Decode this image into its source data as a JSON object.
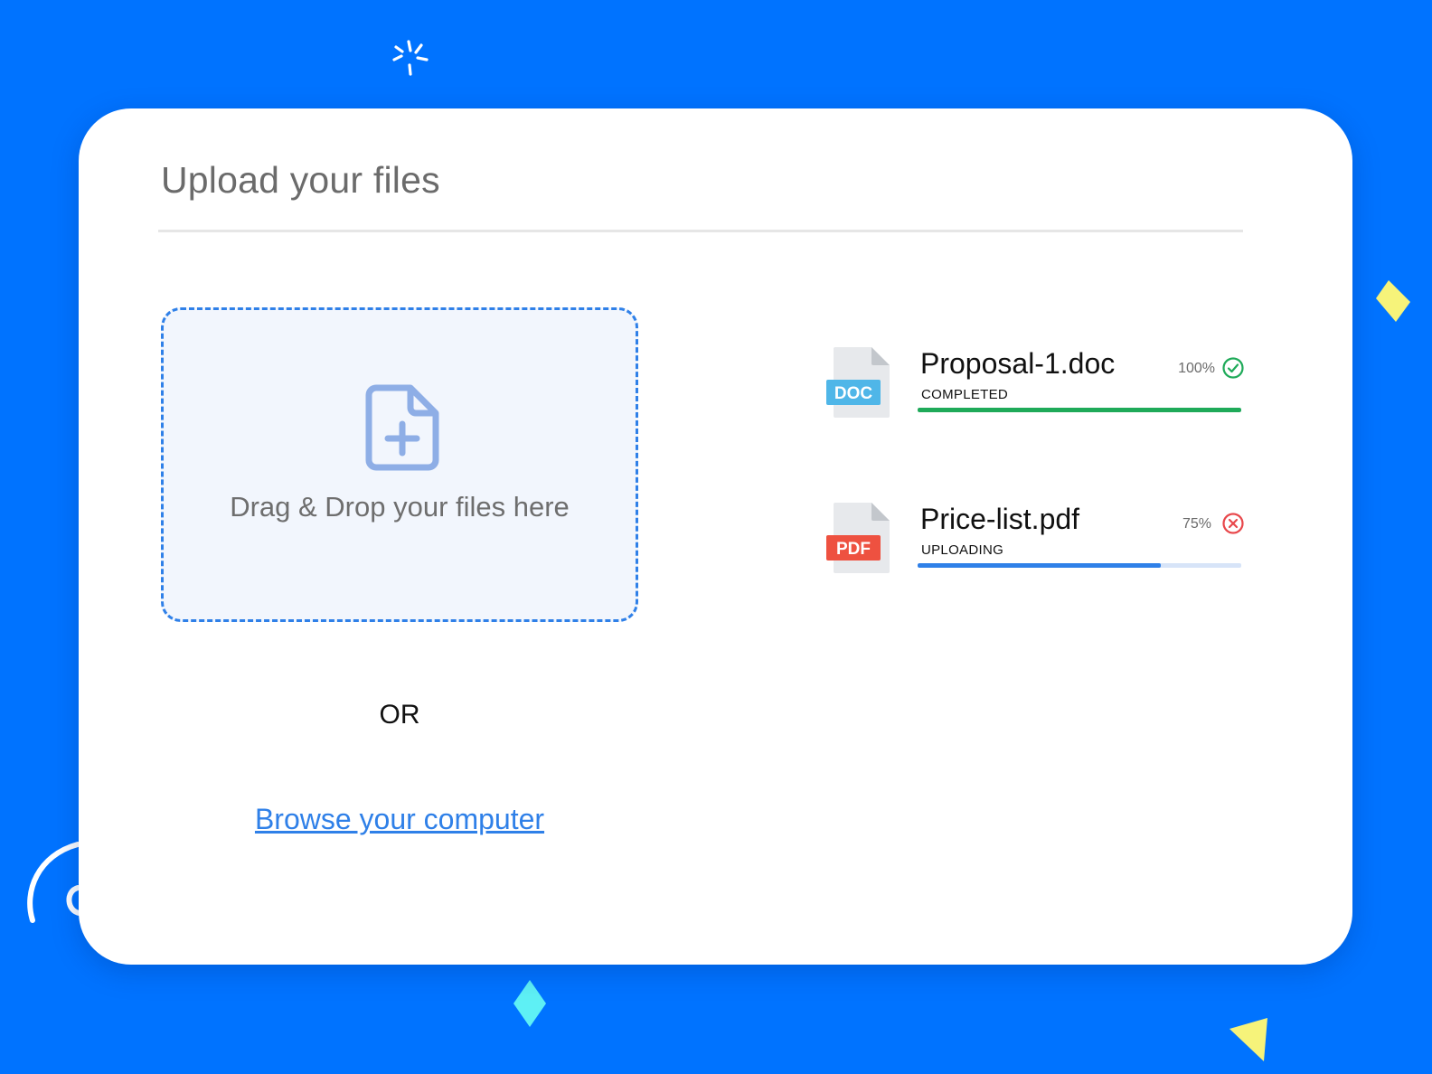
{
  "colors": {
    "background": "#0073ff",
    "card": "#ffffff",
    "accent_blue": "#2f80e8",
    "success_green": "#1faa59",
    "error_red": "#e8474b",
    "doc_badge": "#4fb6e8",
    "pdf_badge": "#ee5140"
  },
  "header": {
    "title": "Upload your files"
  },
  "dropzone": {
    "icon": "file-plus-icon",
    "text": "Drag & Drop your files here"
  },
  "separator": {
    "text": "OR"
  },
  "browse": {
    "label": "Browse your computer"
  },
  "files": [
    {
      "name": "Proposal-1.doc",
      "badge": "DOC",
      "status": "COMPLETED",
      "progress_percent": 100,
      "progress_label": "100%",
      "status_icon": "check-circle-icon"
    },
    {
      "name": "Price-list.pdf",
      "badge": "PDF",
      "status": "UPLOADING",
      "progress_percent": 75,
      "progress_label": "75%",
      "status_icon": "cancel-circle-icon"
    }
  ]
}
